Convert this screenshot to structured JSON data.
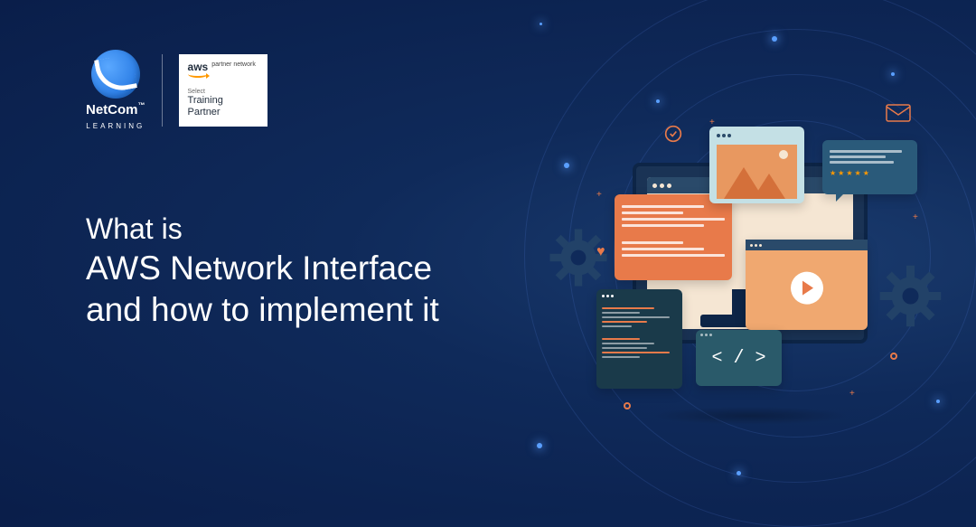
{
  "header": {
    "netcom": {
      "name": "NetCom",
      "tm": "™",
      "subtitle": "LEARNING"
    },
    "aws": {
      "logo": "aws",
      "partner": "partner network",
      "tier": "Select",
      "role": "Training Partner"
    }
  },
  "title": {
    "line1": "What is",
    "line2": "AWS Network Interface",
    "line3": "and how to implement it"
  },
  "illustration": {
    "code_tag": "< / >",
    "stars": "★★★★★"
  }
}
